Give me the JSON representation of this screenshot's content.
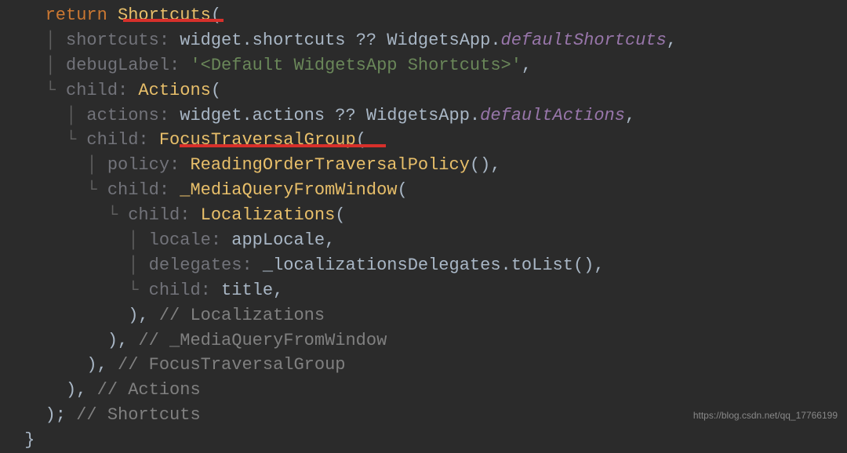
{
  "code": {
    "l1_return": "return",
    "l1_shortcuts": "Shortcuts",
    "l1_paren": "(",
    "l2_param": "shortcuts:",
    "l2_widget": " widget.shortcuts ",
    "l2_op": "?? ",
    "l2_cls": "WidgetsApp",
    "l2_dot": ".",
    "l2_ital": "defaultShortcuts",
    "l2_comma": ",",
    "l3_param": "debugLabel:",
    "l3_str": " '<Default WidgetsApp Shortcuts>'",
    "l3_comma": ",",
    "l4_param": "child:",
    "l4_cls": " Actions",
    "l4_paren": "(",
    "l5_param": "actions:",
    "l5_widget": " widget.actions ",
    "l5_op": "?? ",
    "l5_cls": "WidgetsApp",
    "l5_dot": ".",
    "l5_ital": "defaultActions",
    "l5_comma": ",",
    "l6_param": "child:",
    "l6_cls": " FocusTraversalGroup",
    "l6_paren": "(",
    "l7_param": "policy:",
    "l7_cls": " ReadingOrderTraversalPolicy",
    "l7_parens": "(),",
    "l8_param": "child:",
    "l8_cls": " _MediaQueryFromWindow",
    "l8_paren": "(",
    "l9_param": "child:",
    "l9_cls": " Localizations",
    "l9_paren": "(",
    "l10_param": "locale:",
    "l10_ident": " appLocale",
    "l10_comma": ",",
    "l11_param": "delegates:",
    "l11_ident": " _localizationsDelegates",
    "l11_call": ".toList(),",
    "l12_param": "child:",
    "l12_ident": " title",
    "l12_comma": ",",
    "l13_close": "),",
    "l13_comment": " // Localizations",
    "l14_close": "),",
    "l14_comment": " // _MediaQueryFromWindow",
    "l15_close": "),",
    "l15_comment": " // FocusTraversalGroup",
    "l16_close": "),",
    "l16_comment": " // Actions",
    "l17_close": ");",
    "l17_comment": " // Shortcuts",
    "l18_brace": "}"
  },
  "watermark": "https://blog.csdn.net/qq_17766199"
}
